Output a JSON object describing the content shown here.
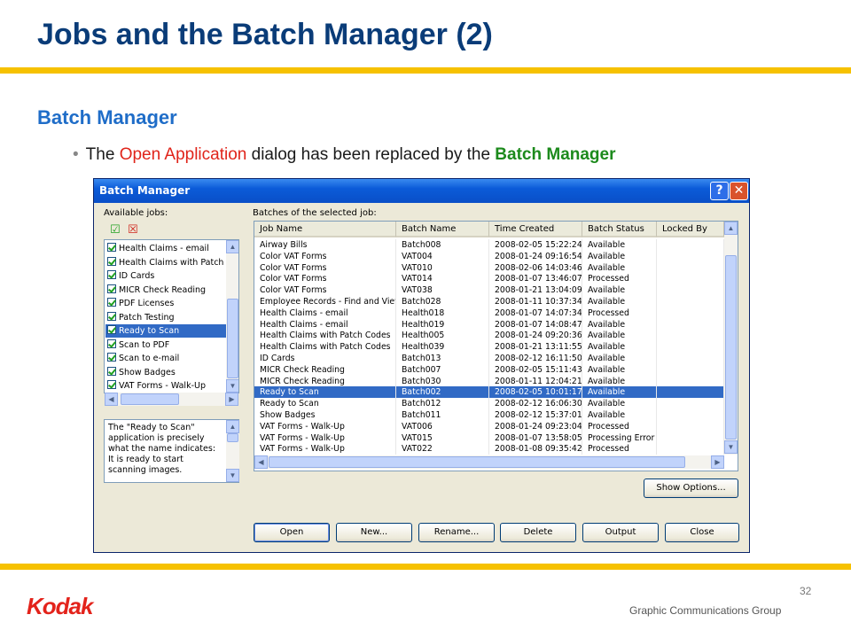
{
  "slide": {
    "title": "Jobs and the Batch Manager (2)",
    "section": "Batch Manager",
    "bullet": {
      "pre": "The ",
      "red": "Open Application",
      "mid": " dialog has been replaced by the ",
      "green": "Batch Manager"
    },
    "page_number": "32",
    "footer": "Graphic Communications Group",
    "logo": "Kodak",
    "accent_color": "#f6c100",
    "title_color": "#0a3c78"
  },
  "dialog": {
    "title": "Batch Manager",
    "help_label": "?",
    "close_label": "✕",
    "available_jobs_label": "Available jobs:",
    "batches_label": "Batches of the selected job:",
    "jobs": [
      "Health Claims - email",
      "Health Claims with Patch Codes",
      "ID Cards",
      "MICR Check Reading",
      "PDF Licenses",
      "Patch Testing",
      "Ready to Scan",
      "Scan to PDF",
      "Scan to e-mail",
      "Show Badges",
      "VAT Forms - Walk-Up"
    ],
    "selected_job": "Ready to Scan",
    "description": "The \"Ready to Scan\" application is precisely what the name indicates: It is ready to start scanning images.",
    "columns": [
      "Job Name",
      "Batch Name",
      "Time Created",
      "Batch Status",
      "Locked By"
    ],
    "rows": [
      [
        "Airway Bills",
        "Batch008",
        "2008-02-05 15:22:24",
        "Available",
        ""
      ],
      [
        "Color VAT Forms",
        "VAT004",
        "2008-01-24 09:16:54",
        "Available",
        ""
      ],
      [
        "Color VAT Forms",
        "VAT010",
        "2008-02-06 14:03:46",
        "Available",
        ""
      ],
      [
        "Color VAT Forms",
        "VAT014",
        "2008-01-07 13:46:07",
        "Processed",
        ""
      ],
      [
        "Color VAT Forms",
        "VAT038",
        "2008-01-21 13:04:09",
        "Available",
        ""
      ],
      [
        "Employee Records - Find and View",
        "Batch028",
        "2008-01-11 10:37:34",
        "Available",
        ""
      ],
      [
        "Health Claims - email",
        "Health018",
        "2008-01-07 14:07:34",
        "Processed",
        ""
      ],
      [
        "Health Claims - email",
        "Health019",
        "2008-01-07 14:08:47",
        "Available",
        ""
      ],
      [
        "Health Claims with Patch Codes",
        "Health005",
        "2008-01-24 09:20:36",
        "Available",
        ""
      ],
      [
        "Health Claims with Patch Codes",
        "Health039",
        "2008-01-21 13:11:55",
        "Available",
        ""
      ],
      [
        "ID Cards",
        "Batch013",
        "2008-02-12 16:11:50",
        "Available",
        ""
      ],
      [
        "MICR Check Reading",
        "Batch007",
        "2008-02-05 15:11:43",
        "Available",
        ""
      ],
      [
        "MICR Check Reading",
        "Batch030",
        "2008-01-11 12:04:21",
        "Available",
        ""
      ],
      [
        "Ready to Scan",
        "Batch002",
        "2008-02-05 10:01:17",
        "Available",
        ""
      ],
      [
        "Ready to Scan",
        "Batch012",
        "2008-02-12 16:06:30",
        "Available",
        ""
      ],
      [
        "Show Badges",
        "Batch011",
        "2008-02-12 15:37:01",
        "Available",
        ""
      ],
      [
        "VAT Forms - Walk-Up",
        "VAT006",
        "2008-01-24 09:23:04",
        "Processed",
        ""
      ],
      [
        "VAT Forms - Walk-Up",
        "VAT015",
        "2008-01-07 13:58:05",
        "Processing Error",
        ""
      ],
      [
        "VAT Forms - Walk-Up",
        "VAT022",
        "2008-01-08 09:35:42",
        "Processed",
        ""
      ]
    ],
    "selected_row": 13,
    "show_options_label": "Show Options...",
    "buttons": [
      "Open",
      "New...",
      "Rename...",
      "Delete",
      "Output",
      "Close"
    ]
  }
}
